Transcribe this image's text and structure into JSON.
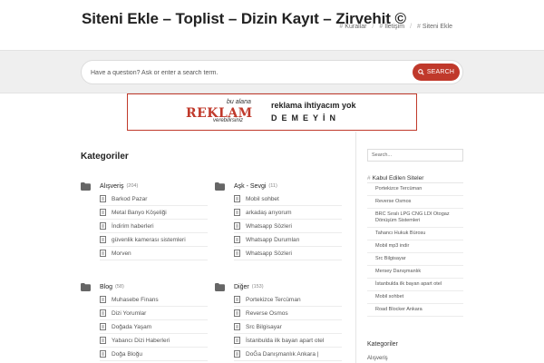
{
  "header": {
    "site_title": "Siteni Ekle – Toplist – Dizin Kayıt – Zirvehit ©",
    "nav": [
      {
        "label": "Kurallar"
      },
      {
        "label": "İletişim"
      },
      {
        "label": "Siteni Ekle"
      }
    ],
    "nav_prefix": "#",
    "nav_separator": "/"
  },
  "search": {
    "placeholder": "Have a question? Ask or enter a search term.",
    "button_label": "SEARCH"
  },
  "banner": {
    "small_top": "bu alana",
    "big": "REKLAM",
    "small_bottom": "verebilirsiniz",
    "right_line1": "reklama ihtiyacım yok",
    "right_line2": "DEMEYİN"
  },
  "main": {
    "section_title": "Kategoriler",
    "categories": [
      {
        "name": "Alışveriş",
        "count": "(204)",
        "items": [
          "Barkod Pazar",
          "Metal Banyo Köşeliği",
          "İndirim haberleri",
          "güvenlik kamerası sistemleri",
          "Morven"
        ]
      },
      {
        "name": "Aşk - Sevgi",
        "count": "(11)",
        "items": [
          "Mobil sohbet",
          "arkadaş arıyorum",
          "Whatsapp Sözleri",
          "Whatsapp Durumları",
          "Whatsapp Sözleri"
        ]
      },
      {
        "name": "Blog",
        "count": "(58)",
        "items": [
          "Muhasebe Finans",
          "Dizi Yorumlar",
          "Doğada Yaşam",
          "Yabancı Dizi Haberleri",
          "Doğa Bloğu"
        ]
      },
      {
        "name": "Diğer",
        "count": "(153)",
        "items": [
          "Portekizce Tercüman",
          "Reverse Osmos",
          "Src Bilgisayar",
          "İstanbulda ilk bayan apart otel",
          "DoĞa Danışmanlık Ankara |"
        ]
      }
    ]
  },
  "sidebar": {
    "search_placeholder": "Search...",
    "accepted_title": "Kabul Edilen Siteler",
    "accepted_prefix": "#",
    "accepted_sites": [
      "Portekizce Tercüman",
      "Reverse Osmos",
      "BRC Sıralı LPG CNG LDI Otogaz Dönüşüm Sistemleri",
      "Tahancı Hukuk Bürosu",
      "Mobil mp3 indir",
      "Src Bilgisayar",
      "Mersey Danışmanlık",
      "İstanbulda ilk bayan apart otel",
      "Mobil sohbet",
      "Road Blocker Ankara"
    ],
    "categories_title": "Kategoriler",
    "categories_first": "Alışveriş"
  },
  "colors": {
    "accent": "#c0392b",
    "band": "#efefef"
  }
}
